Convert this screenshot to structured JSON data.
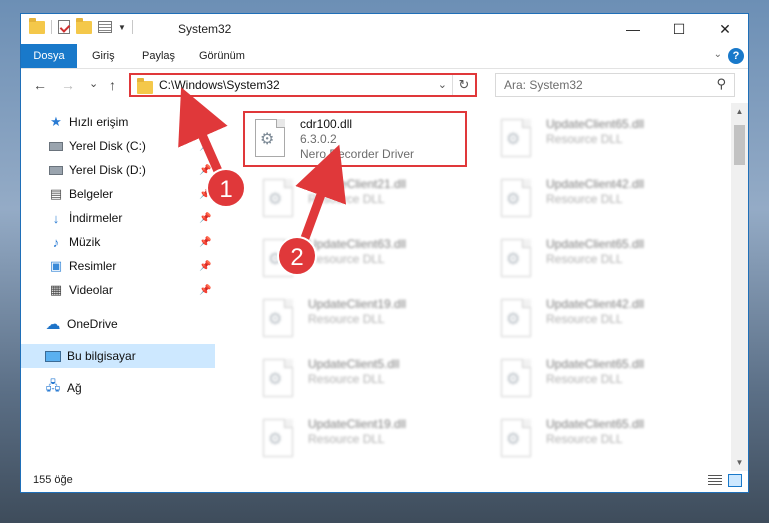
{
  "window": {
    "title": "System32",
    "controls": {
      "minimize": "—",
      "maximize": "☐",
      "close": "✕"
    }
  },
  "ribbon": {
    "tabs": [
      "Dosya",
      "Giriş",
      "Paylaş",
      "Görünüm"
    ],
    "help": "?"
  },
  "nav": {
    "back": "←",
    "forward": "→",
    "recent": "⌄",
    "up": "↑",
    "address": "C:\\Windows\\System32",
    "refresh": "↻",
    "search_placeholder": "Ara: System32"
  },
  "sidebar": {
    "items": [
      {
        "label": "Hızlı erişim",
        "icon": "star-icon"
      },
      {
        "label": "Yerel Disk (C:)",
        "icon": "drive-icon",
        "pinned": true
      },
      {
        "label": "Yerel Disk (D:)",
        "icon": "drive-icon",
        "pinned": true
      },
      {
        "label": "Belgeler",
        "icon": "documents-icon",
        "pinned": true
      },
      {
        "label": "İndirmeler",
        "icon": "download-icon",
        "pinned": true
      },
      {
        "label": "Müzik",
        "icon": "music-icon",
        "pinned": true
      },
      {
        "label": "Resimler",
        "icon": "pictures-icon",
        "pinned": true
      },
      {
        "label": "Videolar",
        "icon": "videos-icon",
        "pinned": true
      },
      {
        "label": "OneDrive",
        "icon": "cloud-icon"
      },
      {
        "label": "Bu bilgisayar",
        "icon": "computer-icon",
        "selected": true
      },
      {
        "label": "Ağ",
        "icon": "network-icon"
      }
    ]
  },
  "files": {
    "highlighted": {
      "name": "cdr100.dll",
      "version": "6.3.0.2",
      "description": "Nero Recorder Driver"
    },
    "blurred": [
      {
        "name": "UpdateClient65.dll",
        "description": "Resource DLL"
      },
      {
        "name": "UpdateClient21.dll",
        "description": "Resource DLL"
      },
      {
        "name": "UpdateClient42.dll",
        "description": "Resource DLL"
      },
      {
        "name": "UpdateClient63.dll",
        "description": "Resource DLL"
      },
      {
        "name": "UpdateClient65.dll",
        "description": "Resource DLL"
      },
      {
        "name": "UpdateClient19.dll",
        "description": "Resource DLL"
      },
      {
        "name": "UpdateClient42.dll",
        "description": "Resource DLL"
      },
      {
        "name": "UpdateClient5.dll",
        "description": "Resource DLL"
      },
      {
        "name": "UpdateClient65.dll",
        "description": "Resource DLL"
      },
      {
        "name": "UpdateClient19.dll",
        "description": "Resource DLL"
      },
      {
        "name": "UpdateClient65.dll",
        "description": "Resource DLL"
      }
    ]
  },
  "status": {
    "count": "155 öğe"
  },
  "annotations": {
    "step1": "1",
    "step2": "2",
    "color": "#e0383a"
  }
}
